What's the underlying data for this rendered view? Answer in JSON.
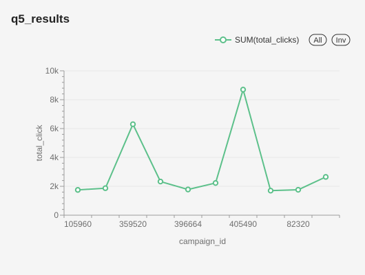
{
  "panel": {
    "title": "q5_results"
  },
  "legend": {
    "all_label": "All",
    "inv_label": "Inv"
  },
  "colors": {
    "series": "#5cc08a",
    "grid": "#e8e8e8",
    "axis": "#9a9a9a"
  },
  "chart_data": {
    "type": "line",
    "x": [
      "105960",
      "",
      "359520",
      "",
      "396664",
      "",
      "405490",
      "",
      "82320",
      ""
    ],
    "tick_labels": [
      "105960",
      "359520",
      "396664",
      "405490",
      "82320"
    ],
    "series": [
      {
        "name": "SUM(total_clicks)",
        "values": [
          1750,
          1870,
          6300,
          2330,
          1780,
          2230,
          8700,
          1700,
          1760,
          2650
        ]
      }
    ],
    "xlabel": "campaign_id",
    "ylabel": "total_click",
    "ylim": [
      0,
      10000
    ],
    "yticks": [
      "0",
      "2k",
      "4k",
      "6k",
      "8k",
      "10k"
    ],
    "grid": true,
    "legend_position": "top-right"
  }
}
